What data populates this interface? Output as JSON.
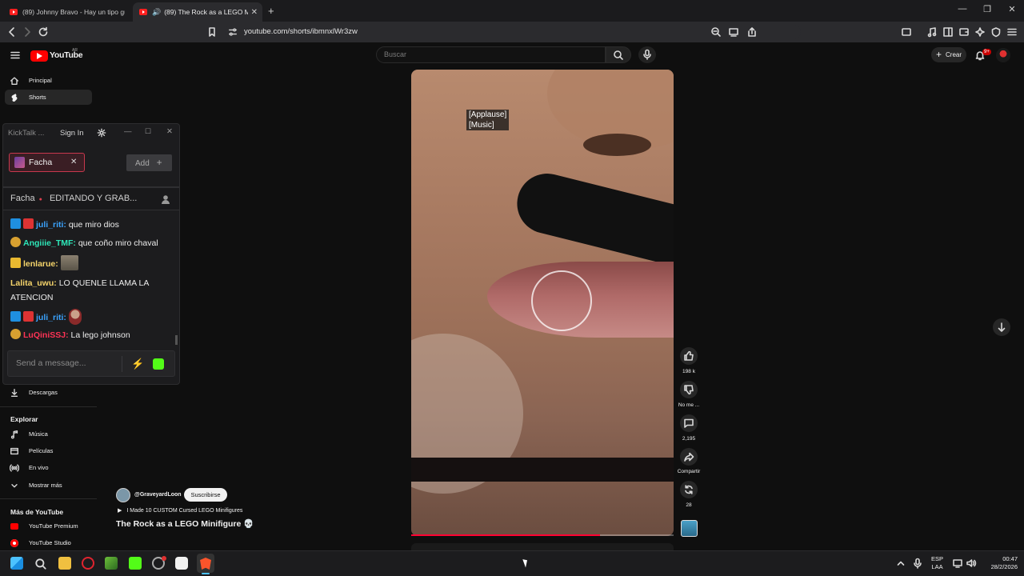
{
  "browser": {
    "tabs": [
      {
        "title": "(89) Johnny Bravo - Hay un tipo guap",
        "active": false
      },
      {
        "title": "(89) The Rock as a LEGO Minif",
        "active": true
      }
    ],
    "url": "youtube.com/shorts/ibmnxlWr3zw",
    "new_tab": "+",
    "window_buttons": [
      "—",
      "❐",
      "✕"
    ]
  },
  "youtube": {
    "logo_text": "YouTube",
    "logo_sup": "AR",
    "search_placeholder": "Buscar",
    "create_label": "Crear",
    "notif_count": "9+",
    "sidebar": {
      "top": [
        {
          "label": "Principal",
          "icon": "home-icon"
        },
        {
          "label": "Shorts",
          "icon": "shorts-icon"
        }
      ],
      "downloads": "Descargas",
      "explore_title": "Explorar",
      "explore": [
        {
          "label": "Música",
          "icon": "music-icon"
        },
        {
          "label": "Películas",
          "icon": "film-icon"
        },
        {
          "label": "En vivo",
          "icon": "live-icon"
        },
        {
          "label": "Mostrar más",
          "icon": "chevron-down-icon"
        }
      ],
      "more_title": "Más de YouTube",
      "more": [
        {
          "label": "YouTube Premium",
          "icon": "premium-icon"
        },
        {
          "label": "YouTube Studio",
          "icon": "studio-icon"
        }
      ]
    },
    "short": {
      "caption_text": "[Applause]\n[Music]",
      "progress": 0.72,
      "actions": [
        {
          "icon": "like-icon",
          "label": "198 k"
        },
        {
          "icon": "dislike-icon",
          "label": "No me ..."
        },
        {
          "icon": "comment-icon",
          "label": "2,195"
        },
        {
          "icon": "share-icon",
          "label": "Compartir"
        },
        {
          "icon": "remix-icon",
          "label": "28"
        }
      ],
      "channel": "@GraveyardLoon",
      "subscribe": "Suscribirse",
      "playlist_title": "I Made 10 CUSTOM Cursed LEGO Minifigures",
      "title": "The Rock as a LEGO Minifigure 💀"
    }
  },
  "kicktalk": {
    "app_name": "KickTalk ...",
    "sign_in": "Sign In",
    "tab_label": "Facha",
    "add_label": "Add",
    "channel_name": "Facha",
    "channel_status": "EDITANDO Y GRAB...",
    "messages": [
      {
        "user": "juli_riti:",
        "text": "que miro dios",
        "color": "#3ba4ff"
      },
      {
        "user": "Angiiie_TMF:",
        "text": "que coño miro chaval",
        "color": "#2ee6b8"
      },
      {
        "user": "lenlarue:",
        "text": "",
        "color": "#f5d46b"
      },
      {
        "user": "Lalita_uwu:",
        "text": "LO QUENLE LLAMA LA ATENCION",
        "color": "#f5d46b"
      },
      {
        "user": "juli_riti:",
        "text": "",
        "color": "#3ba4ff"
      },
      {
        "user": "LuQiniSSJ:",
        "text": "La lego johnson",
        "color": "#ff3355"
      }
    ],
    "input_placeholder": "Send a message..."
  },
  "taskbar": {
    "lang": "ESP",
    "lang2": "LAA",
    "time": "00:47",
    "date": "28/2/2026"
  }
}
